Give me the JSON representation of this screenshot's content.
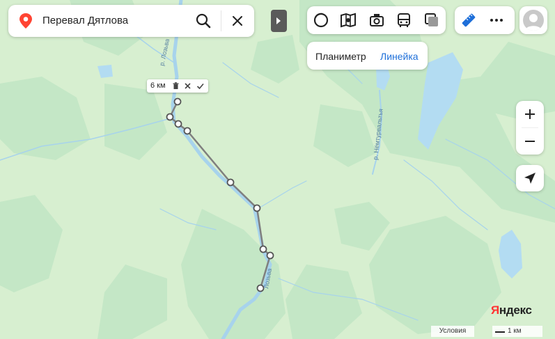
{
  "search": {
    "query": "Перевал Дятлова",
    "icons": [
      "location-pin-icon",
      "search-icon",
      "close-icon"
    ]
  },
  "layers": {
    "icons": [
      "map-type-icon",
      "traffic-icon",
      "panorama-icon",
      "transit-icon",
      "layers-icon"
    ]
  },
  "tools": {
    "icons": [
      "ruler-icon",
      "more-icon"
    ]
  },
  "measure_modes": {
    "area_label": "Планиметр",
    "ruler_label": "Линейка",
    "active": "Линейка"
  },
  "ruler": {
    "distance": "6 км",
    "icons": [
      "delete-icon",
      "close-icon",
      "check-icon"
    ]
  },
  "map_labels": {
    "river_north": "р. Лозьва",
    "river_east": "р. Нёмтурвальтья",
    "river_south": "Лозьва"
  },
  "brand": {
    "part1": "Я",
    "part2": "ндекс"
  },
  "footer": {
    "terms": "Условия",
    "scale": "1 км"
  },
  "colors": {
    "land": "#d7efd0",
    "forest": "#c2e6c4",
    "water": "#b3dcf2",
    "river_line": "#a7d3ec",
    "ruler_line": "#7f7f7f",
    "accent_blue": "#1e6fd9",
    "pin_red": "#ff4433"
  }
}
